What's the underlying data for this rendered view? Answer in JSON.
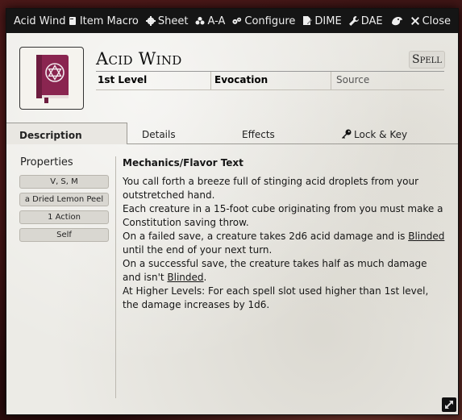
{
  "window": {
    "title": "Acid Wind",
    "header_buttons": [
      {
        "label": "Item Macro",
        "icon": "scroll-icon"
      },
      {
        "label": "Sheet",
        "icon": "gear-icon"
      },
      {
        "label": "A-A",
        "icon": "biohazard-icon"
      },
      {
        "label": "Configure",
        "icon": "cogs-icon"
      },
      {
        "label": "DIME",
        "icon": "file-pen-icon"
      },
      {
        "label": "DAE",
        "icon": "wrench-icon"
      },
      {
        "label": "",
        "icon": "dragon-icon"
      },
      {
        "label": "Close",
        "icon": "close-icon"
      }
    ]
  },
  "item": {
    "name": "Acid Wind",
    "type": "Spell",
    "level": "1st Level",
    "school": "Evocation",
    "source_placeholder": "Source",
    "portrait_icon": "spellbook-icon",
    "portrait_color": "#8a2550"
  },
  "tabs": [
    {
      "label": "Description",
      "active": true
    },
    {
      "label": "Details"
    },
    {
      "label": "Effects"
    },
    {
      "label": "Lock & Key",
      "icon": "key-icon"
    }
  ],
  "properties": {
    "heading": "Properties",
    "items": [
      "V, S, M",
      "a Dried Lemon Peel",
      "1 Action",
      "Self"
    ]
  },
  "description": {
    "heading": "Mechanics/Flavor Text",
    "p1": "You call forth a breeze full of stinging acid droplets from your outstretched hand.",
    "p2": "Each creature in a 15-foot cube originating from you must make a Constitution saving throw.",
    "p3_a": "On a failed save, a creature takes 2d6 acid damage and is ",
    "p3_link": "Blinded",
    "p3_b": " until the end of your next turn.",
    "p4_a": "On a successful save, the creature takes half as much damage and isn't ",
    "p4_link": "Blinded",
    "p4_b": ".",
    "p5": "At Higher Levels: For each spell slot used higher than 1st level, the damage increases by 1d6."
  }
}
